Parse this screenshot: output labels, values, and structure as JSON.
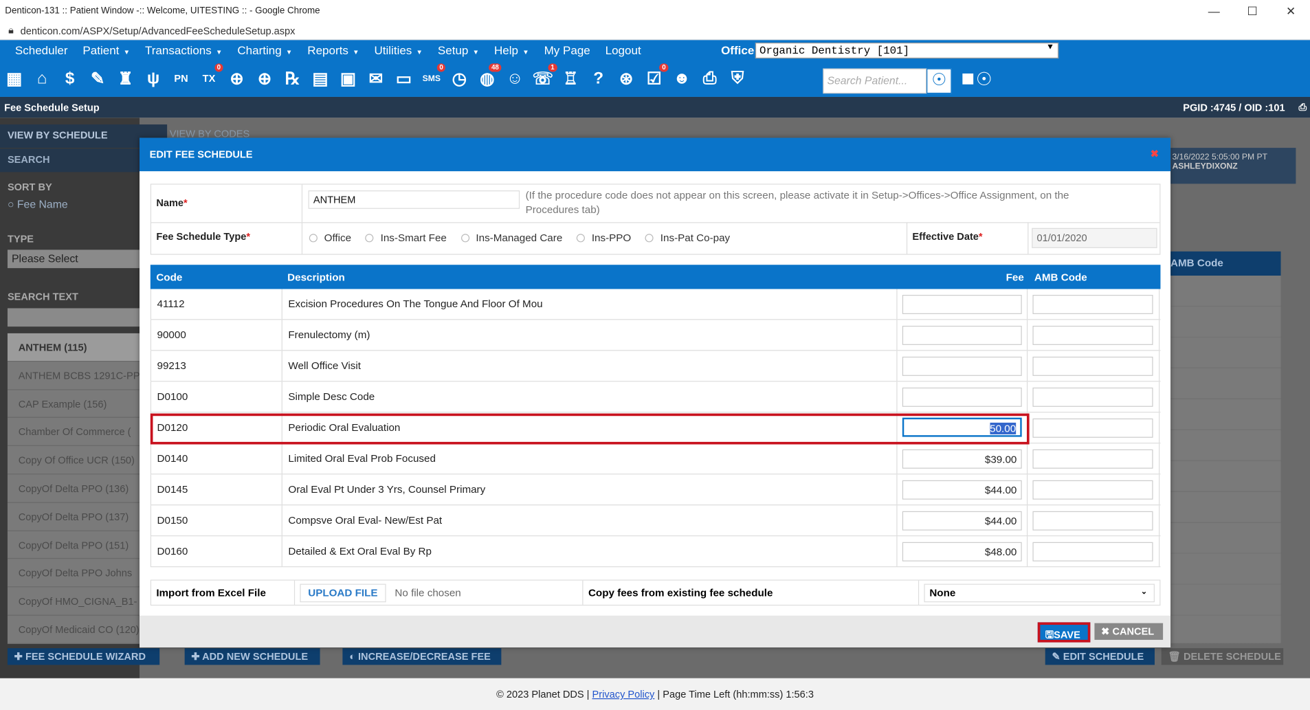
{
  "browser": {
    "title": "Denticon-131 :: Patient Window -:: Welcome, UITESTING :: - Google Chrome",
    "url": "denticon.com/ASPX/Setup/AdvancedFeeScheduleSetup.aspx"
  },
  "menu": {
    "items": [
      {
        "label": "Scheduler"
      },
      {
        "label": "Patient",
        "caret": "▼"
      },
      {
        "label": "Transactions",
        "caret": "▼"
      },
      {
        "label": "Charting",
        "caret": "▼"
      },
      {
        "label": "Reports",
        "caret": "▼"
      },
      {
        "label": "Utilities",
        "caret": "▼"
      },
      {
        "label": "Setup",
        "caret": "▼"
      },
      {
        "label": "Help",
        "caret": "▼"
      },
      {
        "label": "My Page"
      },
      {
        "label": "Logout"
      }
    ],
    "office_label": "Office",
    "office_value": "Organic Dentistry [101]"
  },
  "toolbar": {
    "search_placeholder": "Search Patient...",
    "badges": {
      "tx": "0",
      "sms": "0",
      "web": "48",
      "alerts": "1",
      "notes": "0"
    }
  },
  "subheader": {
    "title": "Fee Schedule Setup",
    "ids": "PGID :4745 / OID :101"
  },
  "left_panel": {
    "tab_schedule": "VIEW BY SCHEDULE",
    "tab_codes": "VIEW BY CODES",
    "tab_search": "SEARCH",
    "sort_label": "SORT BY",
    "sort_option": "Fee Name",
    "type_label": "TYPE",
    "type_value": "Please Select",
    "search_text_label": "SEARCH TEXT",
    "schedules": [
      "ANTHEM (115)",
      "ANTHEM BCBS 1291C-PPO",
      "CAP Example (156)",
      "Chamber Of Commerce (",
      "Copy Of Office UCR (150)",
      "CopyOf Delta PPO (136)",
      "CopyOf Delta PPO (137)",
      "CopyOf Delta PPO (151)",
      "CopyOf Delta PPO Johns",
      "CopyOf HMO_CIGNA_B1-",
      "CopyOf Medicaid CO (120)"
    ]
  },
  "background": {
    "date": "3/16/2022 5:05:00 PM PT",
    "user": "ASHLEYDIXONZ",
    "amb_code": "AMB Code"
  },
  "bottom_buttons": {
    "wizard": "FEE SCHEDULE WIZARD",
    "add": "ADD NEW SCHEDULE",
    "increase": "INCREASE/DECREASE FEE",
    "edit": "EDIT SCHEDULE",
    "delete": "DELETE SCHEDULE"
  },
  "modal": {
    "title": "EDIT FEE SCHEDULE",
    "name_label": "Name",
    "name_value": "ANTHEM",
    "note": "(If the procedure code does not appear on this screen, please activate it in Setup->Offices->Office Assignment, on the Procedures tab)",
    "type_label": "Fee Schedule Type",
    "types": [
      "Office",
      "Ins-Smart Fee",
      "Ins-Managed Care",
      "Ins-PPO",
      "Ins-Pat Co-pay"
    ],
    "effective_label": "Effective Date",
    "effective_value": "01/01/2020",
    "grid_headers": {
      "code": "Code",
      "description": "Description",
      "fee": "Fee",
      "amb": "AMB Code"
    },
    "rows": [
      {
        "code": "41112",
        "description": "Excision Procedures On The Tongue And Floor Of Mou",
        "fee": ""
      },
      {
        "code": "90000",
        "description": "Frenulectomy (m)",
        "fee": ""
      },
      {
        "code": "99213",
        "description": "Well Office Visit",
        "fee": ""
      },
      {
        "code": "D0100",
        "description": "Simple Desc Code",
        "fee": ""
      },
      {
        "code": "D0120",
        "description": "Periodic Oral Evaluation",
        "fee": "50.00"
      },
      {
        "code": "D0140",
        "description": "Limited Oral Eval Prob Focused",
        "fee": "$39.00"
      },
      {
        "code": "D0145",
        "description": "Oral Eval Pt Under 3 Yrs, Counsel Primary",
        "fee": "$44.00"
      },
      {
        "code": "D0150",
        "description": "Compsve Oral Eval- New/Est Pat",
        "fee": "$44.00"
      },
      {
        "code": "D0160",
        "description": "Detailed & Ext Oral Eval By Rp",
        "fee": "$48.00"
      }
    ],
    "import_label": "Import from Excel File",
    "upload_button": "UPLOAD FILE",
    "no_file": "No file chosen",
    "copy_label": "Copy fees from existing fee schedule",
    "copy_value": "None",
    "save": "SAVE",
    "cancel": "CANCEL"
  },
  "footer": {
    "copyright": "© 2023 Planet DDS |",
    "privacy": "Privacy Policy",
    "time_left": "| Page Time Left (hh:mm:ss) 1:56:3"
  }
}
